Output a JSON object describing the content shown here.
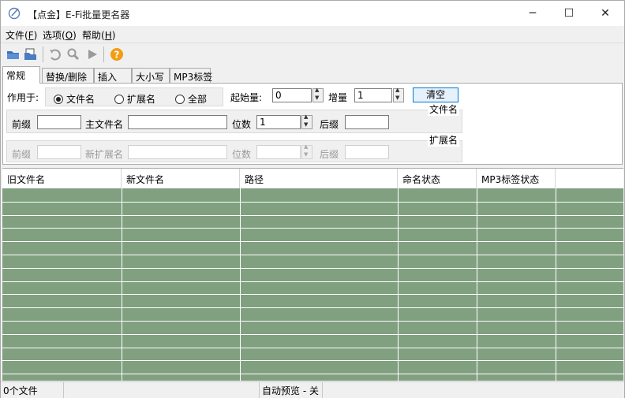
{
  "window": {
    "title": "【点金】E-Fi批量更名器",
    "minimize_glyph": "─",
    "maximize_glyph": "☐",
    "close_glyph": "✕"
  },
  "menu": [
    {
      "label": "文件",
      "key": "F"
    },
    {
      "label": "选项",
      "key": "O"
    },
    {
      "label": "帮助",
      "key": "H"
    }
  ],
  "toolbar": [
    "open-folder-icon",
    "open-files-icon",
    "undo-icon",
    "search-icon",
    "run-icon",
    "help-icon"
  ],
  "tabs": [
    "常规",
    "替换/删除",
    "插入",
    "大小写",
    "MP3标签"
  ],
  "general": {
    "apply_label": "作用于:",
    "apply_options": [
      "文件名",
      "扩展名",
      "全部"
    ],
    "apply_selected": "文件名",
    "start_label": "起始量:",
    "start_value": "0",
    "step_label": "增量",
    "step_value": "1",
    "clear_label": "清空",
    "filename_group": {
      "title": "文件名",
      "prefix_label": "前缀",
      "main_label": "主文件名",
      "digits_label": "位数",
      "digits_value": "1",
      "suffix_label": "后缀"
    },
    "ext_group": {
      "title": "扩展名",
      "prefix_label": "前缀",
      "main_label": "新扩展名",
      "digits_label": "位数",
      "suffix_label": "后缀"
    }
  },
  "table": {
    "columns": [
      "旧文件名",
      "新文件名",
      "路径",
      "命名状态",
      "MP3标签状态"
    ],
    "row_color": "#80a080"
  },
  "status": {
    "file_count": "0个文件",
    "preview": "自动预览 - 关"
  }
}
